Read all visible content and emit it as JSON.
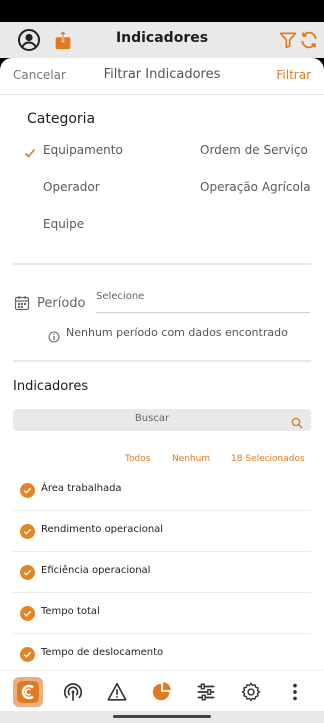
{
  "header": {
    "title": "Indicadores"
  },
  "sheet": {
    "cancel_label": "Cancelar",
    "title": "Filtrar Indicadores",
    "apply_label": "Filtrar"
  },
  "category": {
    "title": "Categoria",
    "options": [
      {
        "label": "Equipamento",
        "selected": true
      },
      {
        "label": "Ordem de Serviço",
        "selected": false
      },
      {
        "label": "Operador",
        "selected": false
      },
      {
        "label": "Operação Agrícola",
        "selected": false
      },
      {
        "label": "Equipe",
        "selected": false
      }
    ]
  },
  "period": {
    "label": "Período",
    "placeholder": "Selecione",
    "info": "Nenhum período com dados encontrado"
  },
  "indicators": {
    "title": "Indicadores",
    "search_placeholder": "Buscar",
    "select_all": "Todos",
    "select_none": "Nenhum",
    "selected_count": "18 Selecionados",
    "items": [
      "Área trabalhada",
      "Rendimento operacional",
      "Eficiência operacional",
      "Tempo total",
      "Tempo de deslocamento"
    ]
  },
  "tabbar": {
    "icons": [
      "app-logo-icon",
      "signal-icon",
      "alert-icon",
      "pie-chart-icon",
      "sliders-icon",
      "gear-icon",
      "more-vertical-icon"
    ]
  },
  "colors": {
    "accent": "#e07b20",
    "checked": "#e38524",
    "header_bg": "#e9e9e9"
  }
}
